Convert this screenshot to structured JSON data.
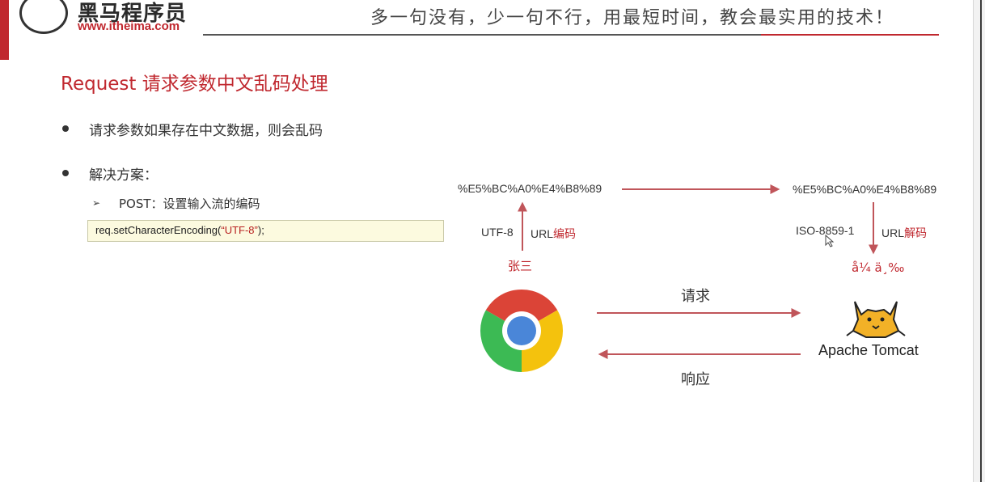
{
  "header": {
    "logo_text": "黑马程序员",
    "logo_url": "www.itheima.com",
    "slogan": "多一句没有，少一句不行，用最短时间，教会最实用的技术！"
  },
  "slide": {
    "title": "Request 请求参数中文乱码处理",
    "bullets": [
      {
        "text": "请求参数如果存在中文数据，则会乱码"
      },
      {
        "text": "解决方案："
      }
    ],
    "sub_bullet": "POST：设置输入流的编码",
    "code": {
      "prefix": "req.setCharacterEncoding(",
      "string": "“UTF-8”",
      "suffix": ");"
    }
  },
  "diagram": {
    "encoded_left": "%E5%BC%A0%E4%B8%89",
    "encoded_right": "%E5%BC%A0%E4%B8%89",
    "charset_left": "UTF-8",
    "charset_right": "ISO-8859-1",
    "url_prefix": "URL",
    "encode_word": "编码",
    "decode_word": "解码",
    "original_text": "张三",
    "garbled_text": "å¼ ä¸‰",
    "request_label": "请求",
    "response_label": "响应",
    "server_name": "Apache Tomcat",
    "browser_icon": "chrome-icon",
    "server_icon": "tomcat-icon",
    "accent_color": "#c0282f"
  }
}
